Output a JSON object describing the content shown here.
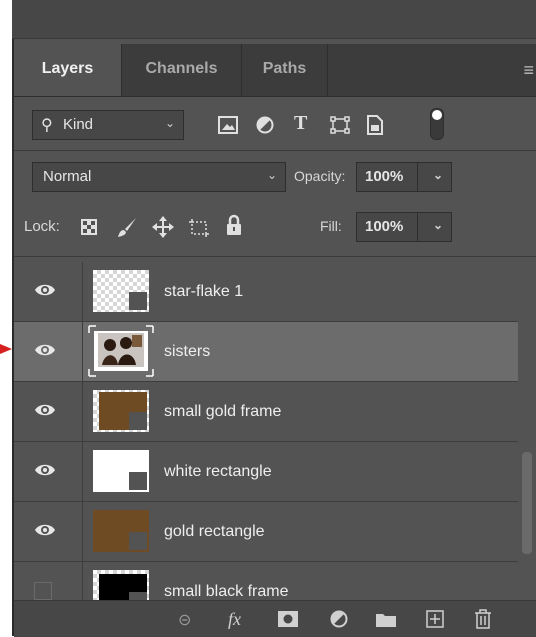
{
  "tabs": [
    "Layers",
    "Channels",
    "Paths"
  ],
  "filter": {
    "kind_label": "Kind"
  },
  "blend": {
    "mode": "Normal",
    "opacity_label": "Opacity:",
    "opacity_value": "100%"
  },
  "lock": {
    "label": "Lock:",
    "fill_label": "Fill:",
    "fill_value": "100%"
  },
  "layers": [
    {
      "name": "star-flake 1",
      "visible": true,
      "selected": false
    },
    {
      "name": "sisters",
      "visible": true,
      "selected": true
    },
    {
      "name": "small gold frame",
      "visible": true,
      "selected": false
    },
    {
      "name": "white rectangle",
      "visible": true,
      "selected": false
    },
    {
      "name": "gold rectangle",
      "visible": true,
      "selected": false
    },
    {
      "name": "small black frame",
      "visible": false,
      "selected": false
    }
  ],
  "colors": {
    "panel": "#535353",
    "gold": "#6e4b23",
    "arrow": "#d62020"
  },
  "icons": [
    "link-icon",
    "fx-icon",
    "mask-icon",
    "adjustment-icon",
    "folder-icon",
    "new-layer-icon",
    "trash-icon"
  ]
}
